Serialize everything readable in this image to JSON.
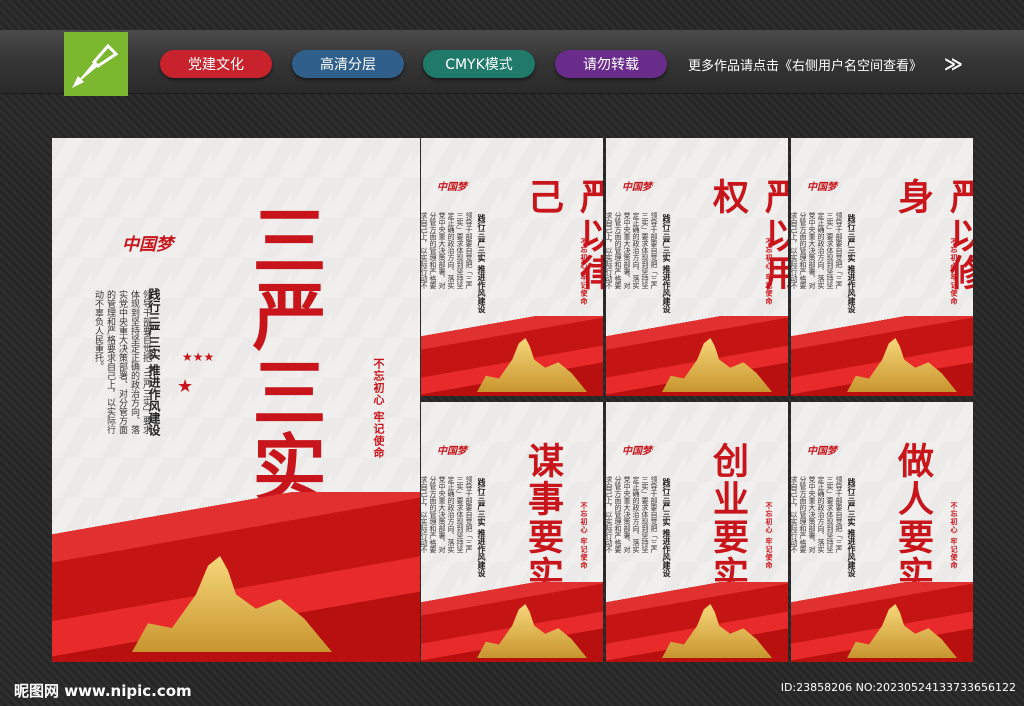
{
  "tags": [
    "党建文化",
    "高清分层",
    "CMYK模式",
    "请勿转载"
  ],
  "more_text": "更多作品请点击《右侧用户名空间查看》",
  "arrows": "≫",
  "main_panel": {
    "title": "三严三实",
    "dream": "中国梦",
    "slogan": "践行三严三实 推进作风建设",
    "body": "领导干部要自觉把「三严三实」要求体现到坚持坚定正确的政治方向、落实党中央重大决策部署、对分管方面的管理和严格要求自己上，以实际行动不辜负人民重托。",
    "motto": "不忘初心 牢记使命"
  },
  "panels": [
    {
      "title": "严以律己"
    },
    {
      "title": "严以用权"
    },
    {
      "title": "严以修身"
    },
    {
      "title": "谋事要实"
    },
    {
      "title": "创业要实"
    },
    {
      "title": "做人要实"
    }
  ],
  "panel_slogan": "践行三严三实 推进作风建设",
  "panel_motto": "不忘初心 牢记使命",
  "panel_dream": "中国梦",
  "watermark": "昵图网 www.nipic.com",
  "image_id": "ID:23858206 NO:20230524133733656122",
  "colors": {
    "accent": "#c8151c",
    "gold": "#d9a53c"
  }
}
